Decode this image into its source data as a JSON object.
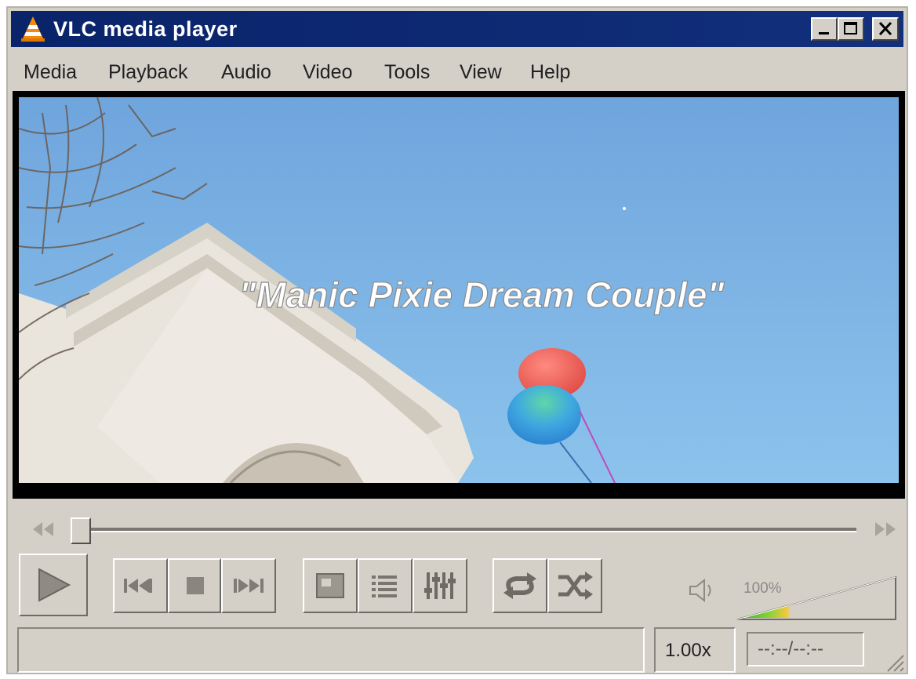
{
  "window": {
    "title": "VLC media player"
  },
  "menu": {
    "items": [
      "Media",
      "Playback",
      "Audio",
      "Video",
      "Tools",
      "View",
      "Help"
    ]
  },
  "video": {
    "subtitle": "\"Manic Pixie Dream Couple\""
  },
  "controls": {
    "play": "play-icon",
    "previous": "previous-icon",
    "stop": "stop-icon",
    "next": "next-icon",
    "fullscreen": "fullscreen-icon",
    "playlist": "playlist-icon",
    "extended_settings": "equalizer-icon",
    "loop": "loop-icon",
    "shuffle": "shuffle-icon"
  },
  "volume": {
    "label": "100%",
    "level": 1.0
  },
  "status": {
    "message": "",
    "speed": "1.00x",
    "time": "--:--/--:--"
  },
  "colors": {
    "titlebar": "#0a246a",
    "window_face": "#d4d0c8",
    "sky": "#7fb2e0"
  }
}
